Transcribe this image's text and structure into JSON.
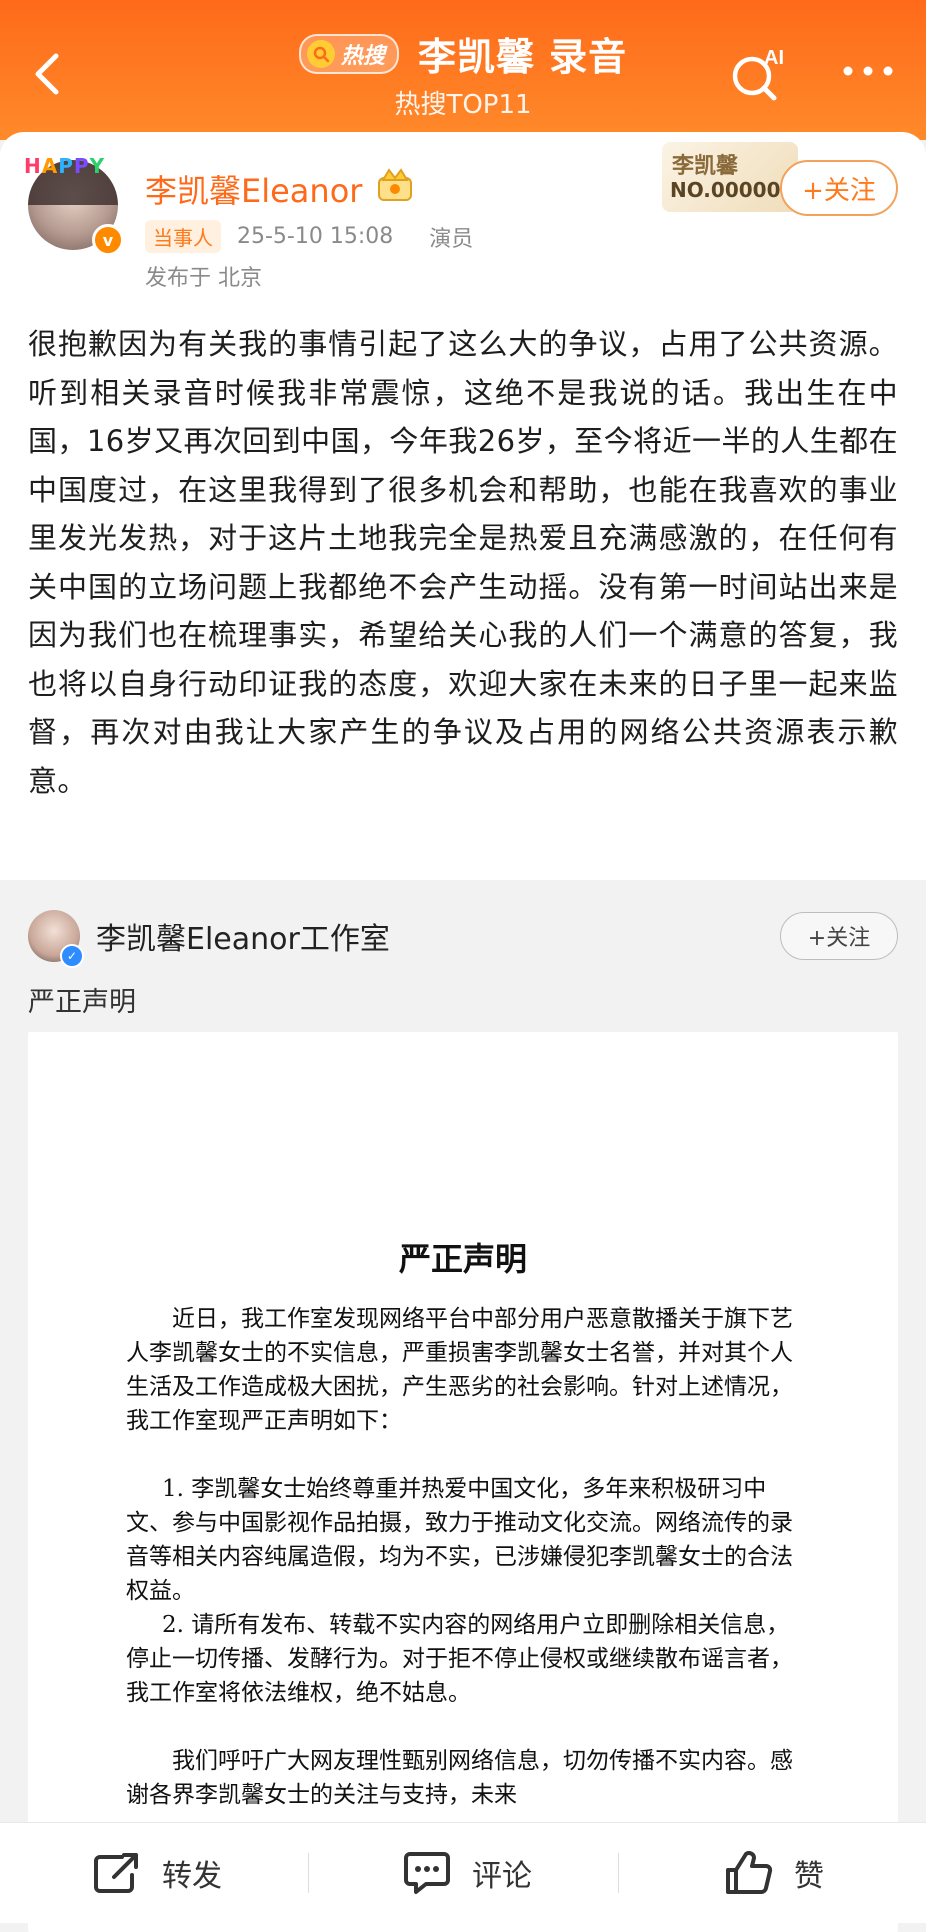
{
  "header": {
    "badge": "热搜",
    "title": "李凯馨 录音",
    "subtitle": "热搜TOP11",
    "ai_label": "AI"
  },
  "post": {
    "avatar_text": "HAPPY",
    "username": "李凯馨Eleanor",
    "tag": "当事人",
    "time": "25-5-10 15:08",
    "role": "演员",
    "location": "发布于 北京",
    "badge_name": "李凯馨",
    "badge_no": "NO.000000",
    "follow": "+关注",
    "text": "很抱歉因为有关我的事情引起了这么大的争议，占用了公共资源。听到相关录音时候我非常震惊，这绝不是我说的话。我出生在中国，16岁又再次回到中国，今年我26岁，至今将近一半的人生都在中国度过，在这里我得到了很多机会和帮助，也能在我喜欢的事业里发光发热，对于这片土地我完全是热爱且充满感激的，在任何有关中国的立场问题上我都绝不会产生动摇。没有第一时间站出来是因为我们也在梳理事实，希望给关心我的人们一个满意的答复，我也将以自身行动印证我的态度，欢迎大家在未来的日子里一起来监督，再次对由我让大家产生的争议及占用的网络公共资源表示歉意。"
  },
  "quoted": {
    "username": "李凯馨Eleanor工作室",
    "follow": "+关注",
    "text": "严正声明",
    "doc": {
      "title": "严正声明",
      "p1": "近日，我工作室发现网络平台中部分用户恶意散播关于旗下艺人李凯馨女士的不实信息，严重损害李凯馨女士名誉，并对其个人生活及工作造成极大困扰，产生恶劣的社会影响。针对上述情况，我工作室现严正声明如下：",
      "item1": "1. 李凯馨女士始终尊重并热爱中国文化，多年来积极研习中文、参与中国影视作品拍摄，致力于推动文化交流。网络流传的录音等相关内容纯属造假，均为不实，已涉嫌侵犯李凯馨女士的合法权益。",
      "item2": "2. 请所有发布、转载不实内容的网络用户立即删除相关信息，停止一切传播、发酵行为。对于拒不停止侵权或继续散布谣言者，我工作室将依法维权，绝不姑息。",
      "p2": "我们呼吁广大网友理性甄别网络信息，切勿传播不实内容。感谢各界李凯馨女士的关注与支持，未来"
    }
  },
  "bottom": {
    "repost": "转发",
    "comment": "评论",
    "like": "赞"
  },
  "colors": {
    "accent": "#ff6a1a",
    "header_gradient_top": "#ff6a1a",
    "header_gradient_bottom": "#ff8a2a"
  }
}
